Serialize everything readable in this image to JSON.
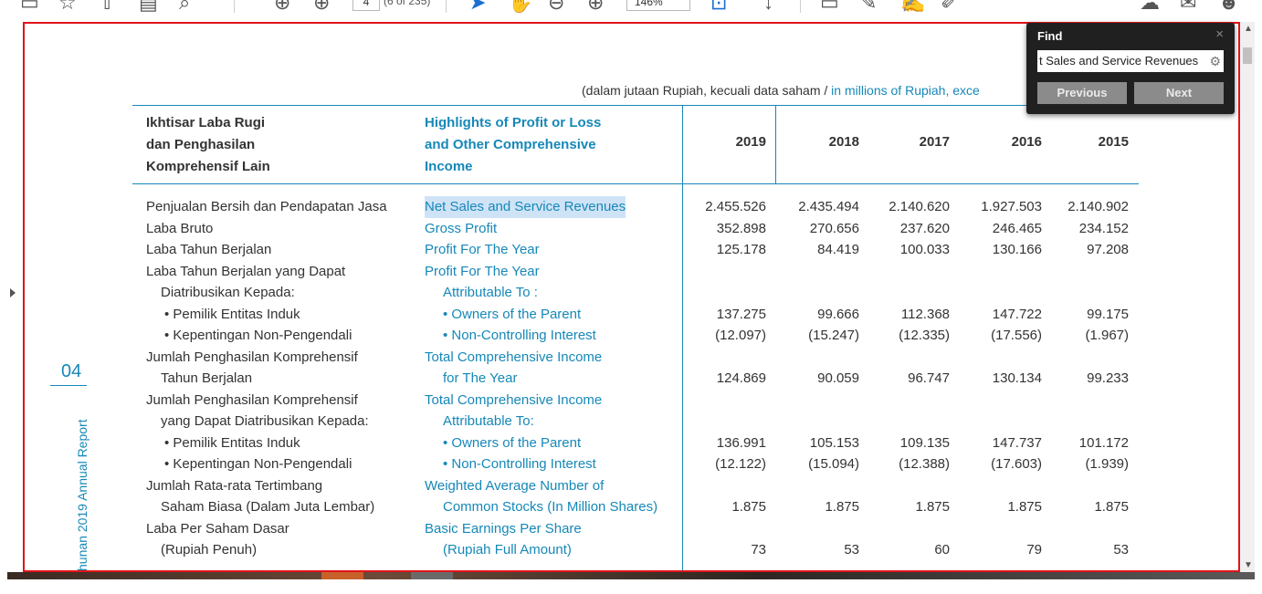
{
  "toolbar": {
    "page_number": "4",
    "page_count": "(6 of 235)",
    "zoom": "146%"
  },
  "document": {
    "units_note_id": "(dalam jutaan Rupiah, kecuali data saham / ",
    "units_note_en": "in millions of Rupiah, exce",
    "side_number": "04",
    "side_text": "hunan 2019 Annual Report",
    "header": {
      "id_lines": [
        "Ikhtisar Laba Rugi",
        "dan Penghasilan",
        "Komprehensif Lain"
      ],
      "en_lines": [
        "Highlights of Profit or Loss",
        "and Other Comprehensive",
        "Income"
      ],
      "years": [
        "2019",
        "2018",
        "2017",
        "2016",
        "2015"
      ]
    },
    "rows": [
      {
        "id": "Penjualan Bersih dan Pendapatan Jasa",
        "en": "Net Sales and Service Revenues",
        "values": [
          "2.455.526",
          "2.435.494",
          "2.140.620",
          "1.927.503",
          "2.140.902"
        ]
      },
      {
        "id": "Laba Bruto",
        "en": "Gross Profit",
        "values": [
          "352.898",
          "270.656",
          "237.620",
          "246.465",
          "234.152"
        ]
      },
      {
        "id": "Laba Tahun Berjalan",
        "en": "Profit For The Year",
        "values": [
          "125.178",
          "84.419",
          "100.033",
          "130.166",
          "97.208"
        ]
      },
      {
        "id": "Laba Tahun Berjalan yang Dapat",
        "en": "Profit For The Year",
        "values": [
          "",
          "",
          "",
          "",
          ""
        ]
      },
      {
        "id": "Diatribusikan Kepada:",
        "en": "Attributable To :",
        "values": [
          "",
          "",
          "",
          "",
          ""
        ]
      },
      {
        "id": "• Pemilik Entitas Induk",
        "en": "• Owners of the Parent",
        "values": [
          "137.275",
          "99.666",
          "112.368",
          "147.722",
          "99.175"
        ]
      },
      {
        "id": "• Kepentingan Non-Pengendali",
        "en": "• Non-Controlling Interest",
        "values": [
          "(12.097)",
          "(15.247)",
          "(12.335)",
          "(17.556)",
          "(1.967)"
        ]
      },
      {
        "id": "Jumlah Penghasilan Komprehensif",
        "en": "Total Comprehensive Income",
        "values": [
          "",
          "",
          "",
          "",
          ""
        ]
      },
      {
        "id": "Tahun Berjalan",
        "en": "for The Year",
        "values": [
          "124.869",
          "90.059",
          "96.747",
          "130.134",
          "99.233"
        ]
      },
      {
        "id": "Jumlah Penghasilan Komprehensif",
        "en": "Total Comprehensive Income",
        "values": [
          "",
          "",
          "",
          "",
          ""
        ]
      },
      {
        "id": "yang Dapat Diatribusikan Kepada:",
        "en": "Attributable To:",
        "values": [
          "",
          "",
          "",
          "",
          ""
        ]
      },
      {
        "id": "• Pemilik Entitas Induk",
        "en": "• Owners of the Parent",
        "values": [
          "136.991",
          "105.153",
          "109.135",
          "147.737",
          "101.172"
        ]
      },
      {
        "id": "• Kepentingan Non-Pengendali",
        "en": "• Non-Controlling Interest",
        "values": [
          "(12.122)",
          "(15.094)",
          "(12.388)",
          "(17.603)",
          "(1.939)"
        ]
      },
      {
        "id": "Jumlah Rata-rata Tertimbang",
        "en": "Weighted Average Number of",
        "values": [
          "",
          "",
          "",
          "",
          ""
        ]
      },
      {
        "id": "Saham Biasa (Dalam Juta Lembar)",
        "en": "Common Stocks (In Million Shares)",
        "values": [
          "1.875",
          "1.875",
          "1.875",
          "1.875",
          "1.875"
        ]
      },
      {
        "id": "Laba Per Saham Dasar",
        "en": "Basic Earnings Per Share",
        "values": [
          "",
          "",
          "",
          "",
          ""
        ]
      },
      {
        "id": "(Rupiah Penuh)",
        "en": "(Rupiah Full Amount)",
        "values": [
          "73",
          "53",
          "60",
          "79",
          "53"
        ]
      }
    ]
  },
  "find": {
    "title": "Find",
    "close": "×",
    "query": "t Sales and Service Revenues",
    "previous_label": "Previous",
    "next_label": "Next"
  },
  "icons": [
    "save-icon",
    "star-icon",
    "upload-icon",
    "print-icon",
    "search-icon",
    "page-up-icon",
    "page-down-icon",
    "select-arrow-icon",
    "hand-icon",
    "zoom-out-icon",
    "zoom-in-icon",
    "fit-page-icon",
    "scroll-icon",
    "comment-icon",
    "highlight-icon",
    "sign-icon",
    "draw-icon",
    "cloud-icon",
    "mail-icon",
    "user-add-icon",
    "gear-icon",
    "close-icon"
  ]
}
